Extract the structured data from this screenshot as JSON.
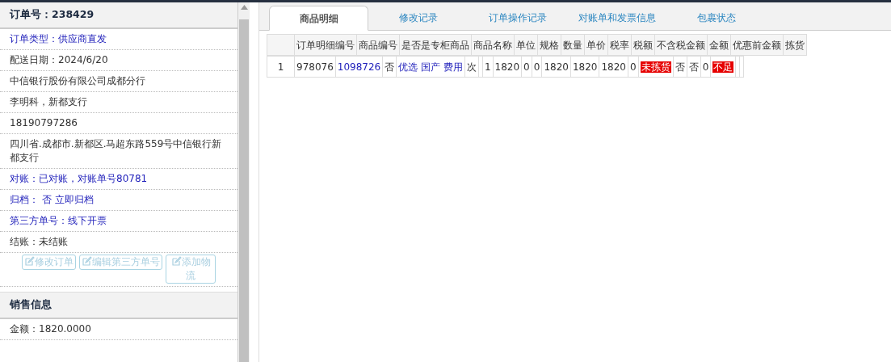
{
  "order_panel": {
    "title": "订单号：238429",
    "rows": [
      {
        "text": "订单类型：供应商直发",
        "highlighted": true
      },
      {
        "text": "配送日期：2024/6/20",
        "highlighted": false
      },
      {
        "text": "中信银行股份有限公司成都分行",
        "highlighted": false
      },
      {
        "text": "李明科，新都支行",
        "highlighted": false
      },
      {
        "text": "18190797286",
        "highlighted": false
      },
      {
        "text": "四川省.成都市.新都区.马超东路559号中信银行新都支行",
        "highlighted": false
      },
      {
        "text": "对账：已对账，对账单号80781",
        "highlighted": true
      },
      {
        "text": "归档：  否 立即归档",
        "highlighted": true
      },
      {
        "text": "第三方单号：线下开票",
        "highlighted": true
      },
      {
        "text": "结账：未结账",
        "highlighted": false
      }
    ],
    "buttons": [
      {
        "label": "修改订单",
        "disabled": true
      },
      {
        "label": "编辑第三方单号",
        "disabled": true
      },
      {
        "label": "添加物流",
        "disabled": true
      }
    ]
  },
  "sales_panel": {
    "title": "销售信息",
    "rows": [
      {
        "text": "金额：1820.0000"
      }
    ]
  },
  "tabs": [
    {
      "label": "商品明细",
      "selected": true
    },
    {
      "label": "修改记录",
      "selected": false
    },
    {
      "label": "订单操作记录",
      "selected": false
    },
    {
      "label": "对账单和发票信息",
      "selected": false
    },
    {
      "label": "包裹状态",
      "selected": false
    }
  ],
  "detail_grid": {
    "header_labels": [
      "订单明细编号",
      "商品编号",
      "是否是专柜商品",
      "商品名称",
      "单位",
      "规格",
      "数量",
      "单价",
      "税率",
      "税额",
      "不含税金额",
      "金额",
      "优惠前金额",
      "拣货"
    ],
    "body_line": {
      "cells": [
        {
          "kind": "index",
          "text": "1"
        },
        {
          "kind": "text",
          "text": "978076"
        },
        {
          "kind": "link",
          "text": "1098726"
        },
        {
          "kind": "text",
          "text": "否"
        },
        {
          "kind": "link",
          "text": "优选 国产 费用"
        },
        {
          "kind": "text",
          "text": "次"
        },
        {
          "kind": "empty"
        },
        {
          "kind": "text",
          "text": "1"
        },
        {
          "kind": "text",
          "text": "1820"
        },
        {
          "kind": "text",
          "text": "0"
        },
        {
          "kind": "text",
          "text": "0"
        },
        {
          "kind": "text",
          "text": "1820"
        },
        {
          "kind": "text",
          "text": "1820"
        },
        {
          "kind": "text",
          "text": "1820"
        },
        {
          "kind": "text",
          "text": "0"
        },
        {
          "kind": "flag",
          "text": "未拣货"
        },
        {
          "kind": "text",
          "text": "否"
        },
        {
          "kind": "text",
          "text": "否"
        },
        {
          "kind": "text",
          "text": "0"
        },
        {
          "kind": "flag",
          "text": "不足"
        },
        {
          "kind": "empty"
        },
        {
          "kind": "empty"
        }
      ]
    }
  }
}
